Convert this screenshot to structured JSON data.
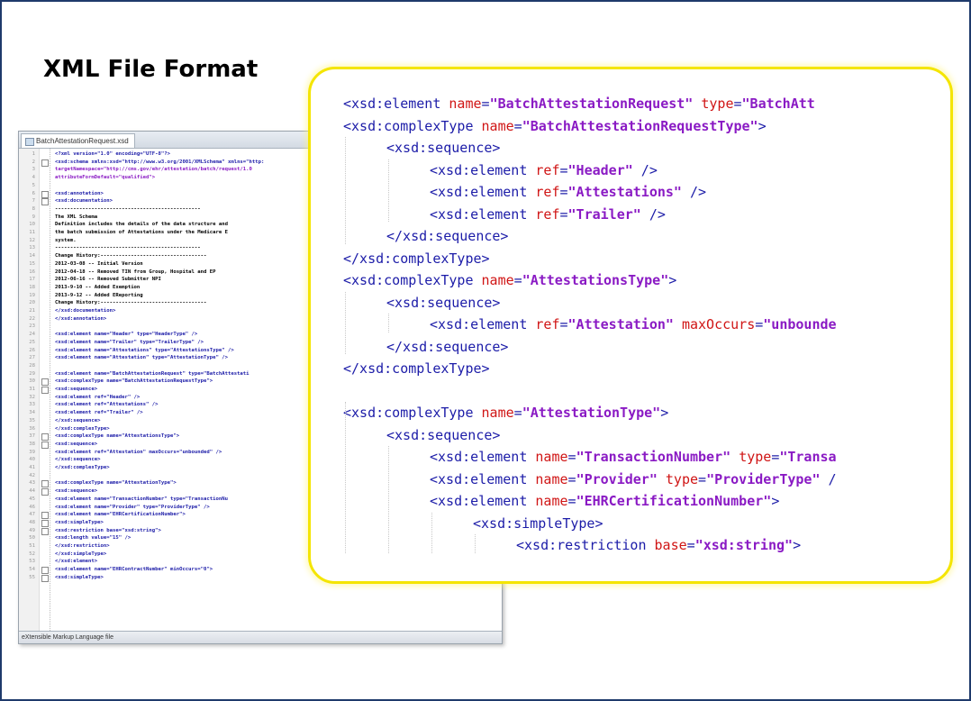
{
  "slide": {
    "title": "XML File Format",
    "accent_border": "#1f3a6b",
    "callout_border": "#f4e500"
  },
  "editor": {
    "tab_label": "BatchAttestationRequest.xsd",
    "status_text": "eXtensible Markup Language file",
    "lines": [
      {
        "n": "1",
        "t": "<?xml version=\"1.0\" encoding=\"UTF-8\"?>",
        "c": "#1c1ca8"
      },
      {
        "n": "2",
        "t": "<xsd:schema xmlns:xsd=\"http://www.w3.org/2001/XMLSchema\" xmlns=\"http:",
        "c": "#1c1ca8"
      },
      {
        "n": "3",
        "t": "    targetNamespace=\"http://cms.gov/ehr/attestation/batch/request/1.0",
        "c": "#8a1ac4"
      },
      {
        "n": "4",
        "t": "    attributeFormDefault=\"qualified\">",
        "c": "#8a1ac4"
      },
      {
        "n": "5",
        "t": "",
        "c": "#000"
      },
      {
        "n": "6",
        "t": "    <xsd:annotation>",
        "c": "#1c1ca8"
      },
      {
        "n": "7",
        "t": "      <xsd:documentation>",
        "c": "#1c1ca8"
      },
      {
        "n": "8",
        "t": "        ------------------------------------------------",
        "c": "#000"
      },
      {
        "n": "9",
        "t": "        The XML Schema",
        "c": "#000"
      },
      {
        "n": "10",
        "t": "        Definition includes the details of the data structure and",
        "c": "#000"
      },
      {
        "n": "11",
        "t": "        the batch submission of Attestations under the Medicare E",
        "c": "#000"
      },
      {
        "n": "12",
        "t": "        system.",
        "c": "#000"
      },
      {
        "n": "13",
        "t": "        ------------------------------------------------",
        "c": "#000"
      },
      {
        "n": "14",
        "t": "        Change History:-----------------------------------",
        "c": "#000"
      },
      {
        "n": "15",
        "t": "        2012-03-08 -- Initial Version",
        "c": "#000"
      },
      {
        "n": "16",
        "t": "        2012-04-18 -- Removed TIN from Group, Hospital and EP",
        "c": "#000"
      },
      {
        "n": "17",
        "t": "        2012-06-16 -- Removed Submitter NPI",
        "c": "#000"
      },
      {
        "n": "18",
        "t": "        2013-9-10  -- Added Exemption",
        "c": "#000"
      },
      {
        "n": "19",
        "t": "        2013-9-12  -- Added EReporting",
        "c": "#000"
      },
      {
        "n": "20",
        "t": "        Change History:-----------------------------------",
        "c": "#000"
      },
      {
        "n": "21",
        "t": "      </xsd:documentation>",
        "c": "#1c1ca8"
      },
      {
        "n": "22",
        "t": "    </xsd:annotation>",
        "c": "#1c1ca8"
      },
      {
        "n": "23",
        "t": "",
        "c": "#000"
      },
      {
        "n": "24",
        "t": "    <xsd:element name=\"Header\" type=\"HeaderType\" />",
        "c": "#1c1ca8"
      },
      {
        "n": "25",
        "t": "    <xsd:element name=\"Trailer\" type=\"TrailerType\" />",
        "c": "#1c1ca8"
      },
      {
        "n": "26",
        "t": "    <xsd:element name=\"Attestations\" type=\"AttestationsType\" />",
        "c": "#1c1ca8"
      },
      {
        "n": "27",
        "t": "    <xsd:element name=\"Attestation\" type=\"AttestationType\" />",
        "c": "#1c1ca8"
      },
      {
        "n": "28",
        "t": "",
        "c": "#000"
      },
      {
        "n": "29",
        "t": "    <xsd:element name=\"BatchAttestationRequest\" type=\"BatchAttestati",
        "c": "#1c1ca8"
      },
      {
        "n": "30",
        "t": "    <xsd:complexType name=\"BatchAttestationRequestType\">",
        "c": "#1c1ca8"
      },
      {
        "n": "31",
        "t": "      <xsd:sequence>",
        "c": "#1c1ca8"
      },
      {
        "n": "32",
        "t": "        <xsd:element ref=\"Header\" />",
        "c": "#1c1ca8"
      },
      {
        "n": "33",
        "t": "        <xsd:element ref=\"Attestations\" />",
        "c": "#1c1ca8"
      },
      {
        "n": "34",
        "t": "        <xsd:element ref=\"Trailer\" />",
        "c": "#1c1ca8"
      },
      {
        "n": "35",
        "t": "      </xsd:sequence>",
        "c": "#1c1ca8"
      },
      {
        "n": "36",
        "t": "    </xsd:complexType>",
        "c": "#1c1ca8"
      },
      {
        "n": "37",
        "t": "    <xsd:complexType name=\"AttestationsType\">",
        "c": "#1c1ca8"
      },
      {
        "n": "38",
        "t": "      <xsd:sequence>",
        "c": "#1c1ca8"
      },
      {
        "n": "39",
        "t": "        <xsd:element ref=\"Attestation\" maxOccurs=\"unbounded\" />",
        "c": "#1c1ca8"
      },
      {
        "n": "40",
        "t": "      </xsd:sequence>",
        "c": "#1c1ca8"
      },
      {
        "n": "41",
        "t": "    </xsd:complexType>",
        "c": "#1c1ca8"
      },
      {
        "n": "42",
        "t": "",
        "c": "#000"
      },
      {
        "n": "43",
        "t": "    <xsd:complexType name=\"AttestationType\">",
        "c": "#1c1ca8"
      },
      {
        "n": "44",
        "t": "      <xsd:sequence>",
        "c": "#1c1ca8"
      },
      {
        "n": "45",
        "t": "        <xsd:element name=\"TransactionNumber\" type=\"TransactionNu",
        "c": "#1c1ca8"
      },
      {
        "n": "46",
        "t": "        <xsd:element name=\"Provider\" type=\"ProviderType\" />",
        "c": "#1c1ca8"
      },
      {
        "n": "47",
        "t": "        <xsd:element name=\"EHRCertificationNumber\">",
        "c": "#1c1ca8"
      },
      {
        "n": "48",
        "t": "          <xsd:simpleType>",
        "c": "#1c1ca8"
      },
      {
        "n": "49",
        "t": "            <xsd:restriction base=\"xsd:string\">",
        "c": "#1c1ca8"
      },
      {
        "n": "50",
        "t": "              <xsd:length value=\"15\" />",
        "c": "#1c1ca8"
      },
      {
        "n": "51",
        "t": "            </xsd:restriction>",
        "c": "#1c1ca8"
      },
      {
        "n": "52",
        "t": "          </xsd:simpleType>",
        "c": "#1c1ca8"
      },
      {
        "n": "53",
        "t": "        </xsd:element>",
        "c": "#1c1ca8"
      },
      {
        "n": "54",
        "t": "        <xsd:element name=\"EHRContractNumber\" minOccurs=\"0\">",
        "c": "#1c1ca8"
      },
      {
        "n": "55",
        "t": "          <xsd:simpleType>",
        "c": "#1c1ca8"
      }
    ]
  },
  "callout": {
    "lines": [
      {
        "i": 0,
        "seg": [
          [
            "tag",
            "<xsd:element "
          ],
          [
            "attr",
            "name"
          ],
          [
            "tag",
            "="
          ],
          [
            "val",
            "\"BatchAttestationRequest\""
          ],
          [
            "tag",
            " "
          ],
          [
            "attr",
            "type"
          ],
          [
            "tag",
            "="
          ],
          [
            "val",
            "\"BatchAtt"
          ]
        ]
      },
      {
        "i": 0,
        "seg": [
          [
            "tag",
            "<xsd:complexType "
          ],
          [
            "attr",
            "name"
          ],
          [
            "tag",
            "="
          ],
          [
            "val",
            "\"BatchAttestationRequestType\""
          ],
          [
            "tag",
            ">"
          ]
        ]
      },
      {
        "i": 1,
        "seg": [
          [
            "tag",
            "<xsd:sequence>"
          ]
        ]
      },
      {
        "i": 2,
        "seg": [
          [
            "tag",
            "<xsd:element "
          ],
          [
            "attr",
            "ref"
          ],
          [
            "tag",
            "="
          ],
          [
            "val",
            "\"Header\""
          ],
          [
            "tag",
            " />"
          ]
        ]
      },
      {
        "i": 2,
        "seg": [
          [
            "tag",
            "<xsd:element "
          ],
          [
            "attr",
            "ref"
          ],
          [
            "tag",
            "="
          ],
          [
            "val",
            "\"Attestations\""
          ],
          [
            "tag",
            " />"
          ]
        ]
      },
      {
        "i": 2,
        "seg": [
          [
            "tag",
            "<xsd:element "
          ],
          [
            "attr",
            "ref"
          ],
          [
            "tag",
            "="
          ],
          [
            "val",
            "\"Trailer\""
          ],
          [
            "tag",
            " />"
          ]
        ]
      },
      {
        "i": 1,
        "seg": [
          [
            "tag",
            "</xsd:sequence>"
          ]
        ]
      },
      {
        "i": 0,
        "seg": [
          [
            "tag",
            "</xsd:complexType>"
          ]
        ]
      },
      {
        "i": 0,
        "seg": [
          [
            "tag",
            "<xsd:complexType "
          ],
          [
            "attr",
            "name"
          ],
          [
            "tag",
            "="
          ],
          [
            "val",
            "\"AttestationsType\""
          ],
          [
            "tag",
            ">"
          ]
        ]
      },
      {
        "i": 1,
        "seg": [
          [
            "tag",
            "<xsd:sequence>"
          ]
        ]
      },
      {
        "i": 2,
        "seg": [
          [
            "tag",
            "<xsd:element "
          ],
          [
            "attr",
            "ref"
          ],
          [
            "tag",
            "="
          ],
          [
            "val",
            "\"Attestation\""
          ],
          [
            "tag",
            " "
          ],
          [
            "attr",
            "maxOccurs"
          ],
          [
            "tag",
            "="
          ],
          [
            "val",
            "\"unbounde"
          ]
        ]
      },
      {
        "i": 1,
        "seg": [
          [
            "tag",
            "</xsd:sequence>"
          ]
        ]
      },
      {
        "i": 0,
        "seg": [
          [
            "tag",
            "</xsd:complexType>"
          ]
        ]
      },
      {
        "i": 0,
        "seg": []
      },
      {
        "i": 0,
        "seg": [
          [
            "tag",
            "<xsd:complexType "
          ],
          [
            "attr",
            "name"
          ],
          [
            "tag",
            "="
          ],
          [
            "val",
            "\"AttestationType\""
          ],
          [
            "tag",
            ">"
          ]
        ]
      },
      {
        "i": 1,
        "seg": [
          [
            "tag",
            "<xsd:sequence>"
          ]
        ]
      },
      {
        "i": 2,
        "seg": [
          [
            "tag",
            "<xsd:element "
          ],
          [
            "attr",
            "name"
          ],
          [
            "tag",
            "="
          ],
          [
            "val",
            "\"TransactionNumber\""
          ],
          [
            "tag",
            " "
          ],
          [
            "attr",
            "type"
          ],
          [
            "tag",
            "="
          ],
          [
            "val",
            "\"Transa"
          ]
        ]
      },
      {
        "i": 2,
        "seg": [
          [
            "tag",
            "<xsd:element "
          ],
          [
            "attr",
            "name"
          ],
          [
            "tag",
            "="
          ],
          [
            "val",
            "\"Provider\""
          ],
          [
            "tag",
            " "
          ],
          [
            "attr",
            "type"
          ],
          [
            "tag",
            "="
          ],
          [
            "val",
            "\"ProviderType\""
          ],
          [
            "tag",
            " /"
          ]
        ]
      },
      {
        "i": 2,
        "seg": [
          [
            "tag",
            "<xsd:element "
          ],
          [
            "attr",
            "name"
          ],
          [
            "tag",
            "="
          ],
          [
            "val",
            "\"EHRCertificationNumber\""
          ],
          [
            "tag",
            ">"
          ]
        ]
      },
      {
        "i": 3,
        "seg": [
          [
            "tag",
            "<xsd:simpleType>"
          ]
        ]
      },
      {
        "i": 4,
        "seg": [
          [
            "tag",
            "<xsd:restriction "
          ],
          [
            "attr",
            "base"
          ],
          [
            "tag",
            "="
          ],
          [
            "val",
            "\"xsd:string\""
          ],
          [
            "tag",
            ">"
          ]
        ]
      }
    ]
  }
}
